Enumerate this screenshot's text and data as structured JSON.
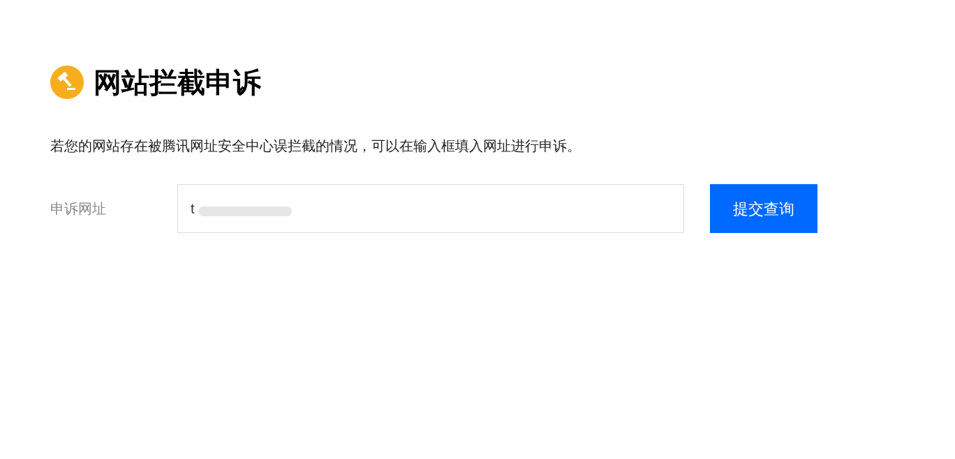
{
  "title": "网站拦截申诉",
  "description": "若您的网站存在被腾讯网址安全中心误拦截的情况，可以在输入框填入网址进行申诉。",
  "form": {
    "label": "申诉网址",
    "value": "t",
    "submit": "提交查询"
  }
}
